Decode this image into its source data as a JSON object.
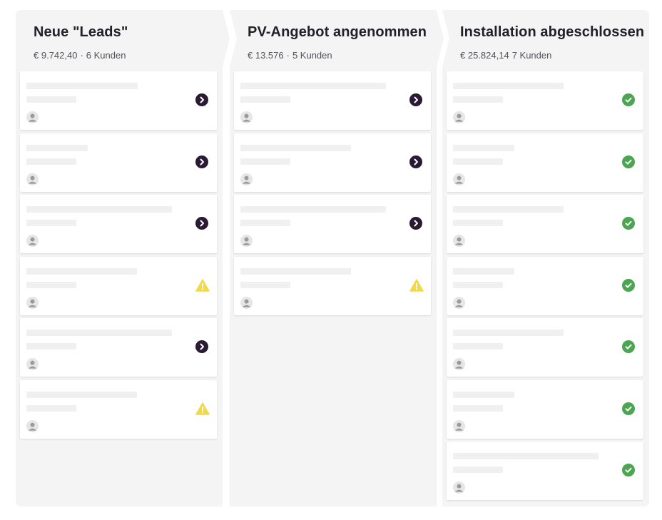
{
  "board": {
    "columns": [
      {
        "title": "Neue \"Leads\"",
        "amount": "€ 9.742,40",
        "separator": "·",
        "count": "6 Kunden",
        "cards": [
          {
            "status": "arrow-right-icon"
          },
          {
            "status": "arrow-right-icon"
          },
          {
            "status": "arrow-right-icon"
          },
          {
            "status": "warning-icon"
          },
          {
            "status": "arrow-right-icon"
          },
          {
            "status": "warning-icon"
          }
        ]
      },
      {
        "title": "PV-Angebot angenommen",
        "amount": "€ 13.576",
        "separator": "·",
        "count": "5 Kunden",
        "cards": [
          {
            "status": "arrow-right-icon"
          },
          {
            "status": "arrow-right-icon"
          },
          {
            "status": "arrow-right-icon"
          },
          {
            "status": "warning-icon"
          }
        ]
      },
      {
        "title": "Installation abgeschlossen",
        "amount": "€ 25.824,14",
        "separator": "",
        "count": "7 Kunden",
        "cards": [
          {
            "status": "check-icon"
          },
          {
            "status": "check-icon"
          },
          {
            "status": "check-icon"
          },
          {
            "status": "check-icon"
          },
          {
            "status": "check-icon"
          },
          {
            "status": "check-icon"
          },
          {
            "status": "check-icon"
          }
        ]
      }
    ]
  },
  "colors": {
    "column_bg": "#f4f4f4",
    "arrow": "#2b1a33",
    "warning": "#f2d84b",
    "check": "#4ba551",
    "placeholder": "#f0f0f0"
  }
}
